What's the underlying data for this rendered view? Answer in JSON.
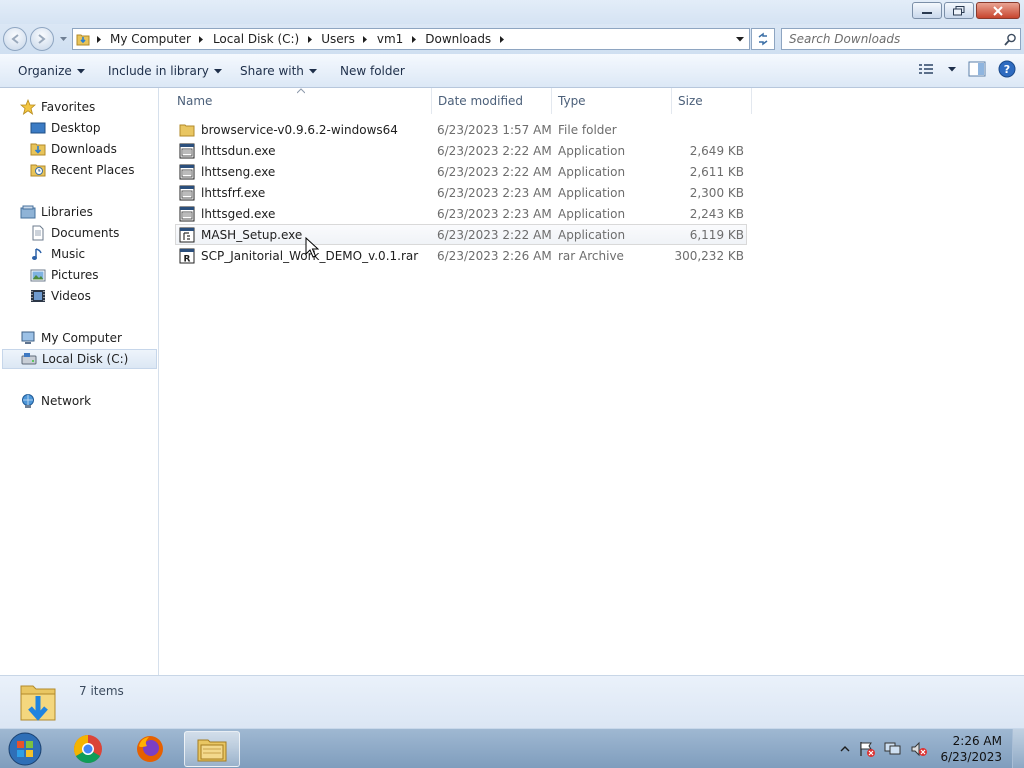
{
  "window": {
    "controls": {
      "minimize": "minimize",
      "maximize": "restore",
      "close": "close"
    }
  },
  "address_bar": {
    "breadcrumbs": [
      "My Computer",
      "Local Disk (C:)",
      "Users",
      "vm1",
      "Downloads"
    ],
    "search_placeholder": "Search Downloads"
  },
  "command_bar": {
    "organize": "Organize",
    "include_in_library": "Include in library",
    "share_with": "Share with",
    "new_folder": "New folder"
  },
  "nav_pane": {
    "favorites": {
      "label": "Favorites",
      "items": [
        "Desktop",
        "Downloads",
        "Recent Places"
      ]
    },
    "libraries": {
      "label": "Libraries",
      "items": [
        "Documents",
        "Music",
        "Pictures",
        "Videos"
      ]
    },
    "computer": {
      "label": "My Computer",
      "items": [
        "Local Disk (C:)"
      ]
    },
    "network": {
      "label": "Network"
    }
  },
  "file_list": {
    "columns": {
      "name": "Name",
      "date": "Date modified",
      "type": "Type",
      "size": "Size"
    },
    "rows": [
      {
        "name": "browservice-v0.9.6.2-windows64",
        "date": "6/23/2023 1:57 AM",
        "type": "File folder",
        "size": "",
        "icon": "folder-icon"
      },
      {
        "name": "lhttsdun.exe",
        "date": "6/23/2023 2:22 AM",
        "type": "Application",
        "size": "2,649 KB",
        "icon": "exe-icon"
      },
      {
        "name": "lhttseng.exe",
        "date": "6/23/2023 2:22 AM",
        "type": "Application",
        "size": "2,611 KB",
        "icon": "exe-icon"
      },
      {
        "name": "lhttsfrf.exe",
        "date": "6/23/2023 2:23 AM",
        "type": "Application",
        "size": "2,300 KB",
        "icon": "exe-icon"
      },
      {
        "name": "lhttsged.exe",
        "date": "6/23/2023 2:23 AM",
        "type": "Application",
        "size": "2,243 KB",
        "icon": "exe-icon"
      },
      {
        "name": "MASH_Setup.exe",
        "date": "6/23/2023 2:22 AM",
        "type": "Application",
        "size": "6,119 KB",
        "icon": "installer-icon"
      },
      {
        "name": "SCP_Janitorial_Work_DEMO_v.0.1.rar",
        "date": "6/23/2023 2:26 AM",
        "type": "rar Archive",
        "size": "300,232 KB",
        "icon": "rar-icon"
      }
    ]
  },
  "details_pane": {
    "item_count": "7 items"
  },
  "taskbar": {
    "apps": [
      "chrome-icon",
      "firefox-icon",
      "explorer-icon"
    ],
    "clock": {
      "time": "2:26 AM",
      "date": "6/23/2023"
    }
  },
  "colors": {
    "accent": "#1e395b",
    "row_hover": "#f0f3f7",
    "details_bg": "#dbe6f4",
    "taskbar": "#8aa7c5"
  }
}
